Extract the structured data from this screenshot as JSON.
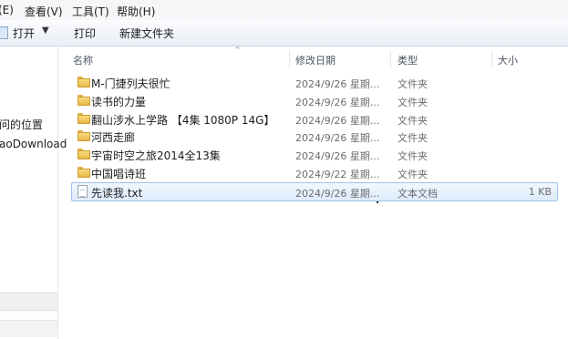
{
  "menubar": {
    "edit": "(E)",
    "view": "查看(V)",
    "tools": "工具(T)",
    "help": "帮助(H)"
  },
  "toolbar": {
    "open": "打开",
    "open_dropdown": "▼",
    "print": "打印",
    "new_folder": "新建文件夹"
  },
  "leftnav": {
    "item1": "问的位置",
    "item2": "aoDownload"
  },
  "columns": {
    "name": "名称",
    "date": "修改日期",
    "type": "类型",
    "size": "大小",
    "sort_arrow": "^"
  },
  "files": [
    {
      "name": "M-门捷列夫很忙",
      "date": "2024/9/26 星期...",
      "type": "文件夹",
      "size": "",
      "icon": "folder-icon"
    },
    {
      "name": "读书的力量",
      "date": "2024/9/26 星期...",
      "type": "文件夹",
      "size": "",
      "icon": "folder-icon"
    },
    {
      "name": "翻山涉水上学路 【4集 1080P 14G】",
      "date": "2024/9/26 星期...",
      "type": "文件夹",
      "size": "",
      "icon": "folder-icon"
    },
    {
      "name": "河西走廊",
      "date": "2024/9/26 星期...",
      "type": "文件夹",
      "size": "",
      "icon": "folder-icon"
    },
    {
      "name": "宇宙时空之旅2014全13集",
      "date": "2024/9/26 星期...",
      "type": "文件夹",
      "size": "",
      "icon": "folder-icon"
    },
    {
      "name": "中国唱诗班",
      "date": "2024/9/22 星期...",
      "type": "文件夹",
      "size": "",
      "icon": "folder-icon"
    },
    {
      "name": "先读我.txt",
      "date": "2024/9/26 星期...",
      "type": "文本文档",
      "size": "1 KB",
      "icon": "text-file-icon"
    }
  ],
  "selected_index": 6,
  "colors": {
    "selection_bg": "#dcebfc",
    "selection_border": "#9ec4ec",
    "folder": "#e8b84b"
  }
}
